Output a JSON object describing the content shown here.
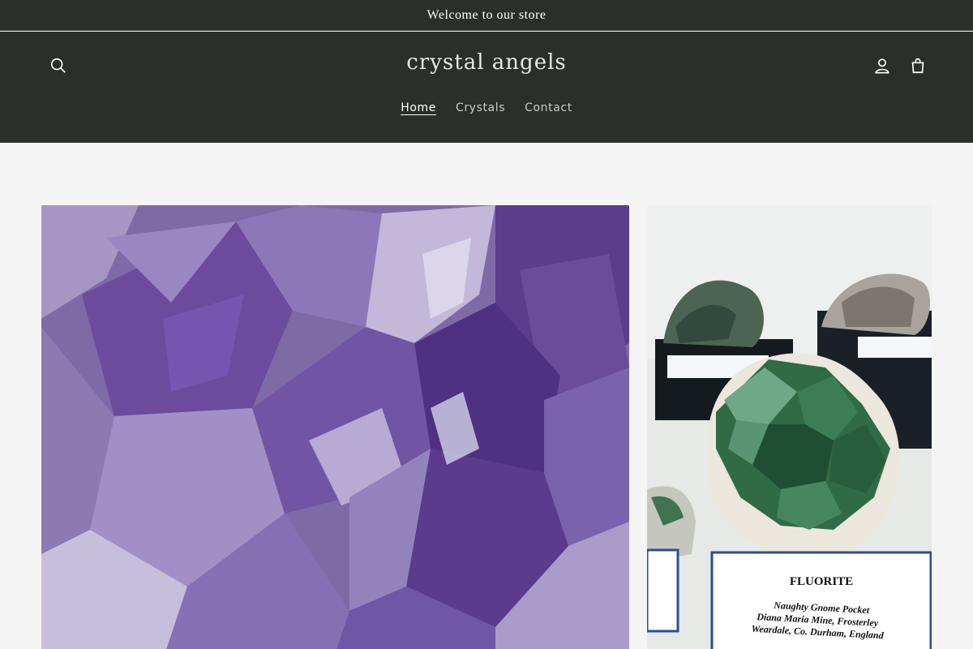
{
  "announcement": {
    "text": "Welcome to our store"
  },
  "header": {
    "logo": "crystal angels",
    "nav": [
      {
        "label": "Home",
        "active": true
      },
      {
        "label": "Crystals",
        "active": false
      },
      {
        "label": "Contact",
        "active": false
      }
    ],
    "icons": {
      "search": "search-icon",
      "account": "account-icon",
      "cart": "cart-icon"
    }
  },
  "gallery": {
    "images": [
      {
        "subject": "amethyst cluster"
      },
      {
        "subject": "fluorite specimen",
        "label_title": "FLUORITE",
        "label_lines": [
          "Naughty Gnome Pocket",
          "Diana Maria Mine, Frosterley",
          "Weardale, Co. Durham, England"
        ]
      }
    ]
  },
  "colors": {
    "header_bg": "#2b2f2c",
    "page_bg": "#f4f4f4",
    "amethyst": "#6b4f98",
    "fluorite": "#2f6b45"
  }
}
